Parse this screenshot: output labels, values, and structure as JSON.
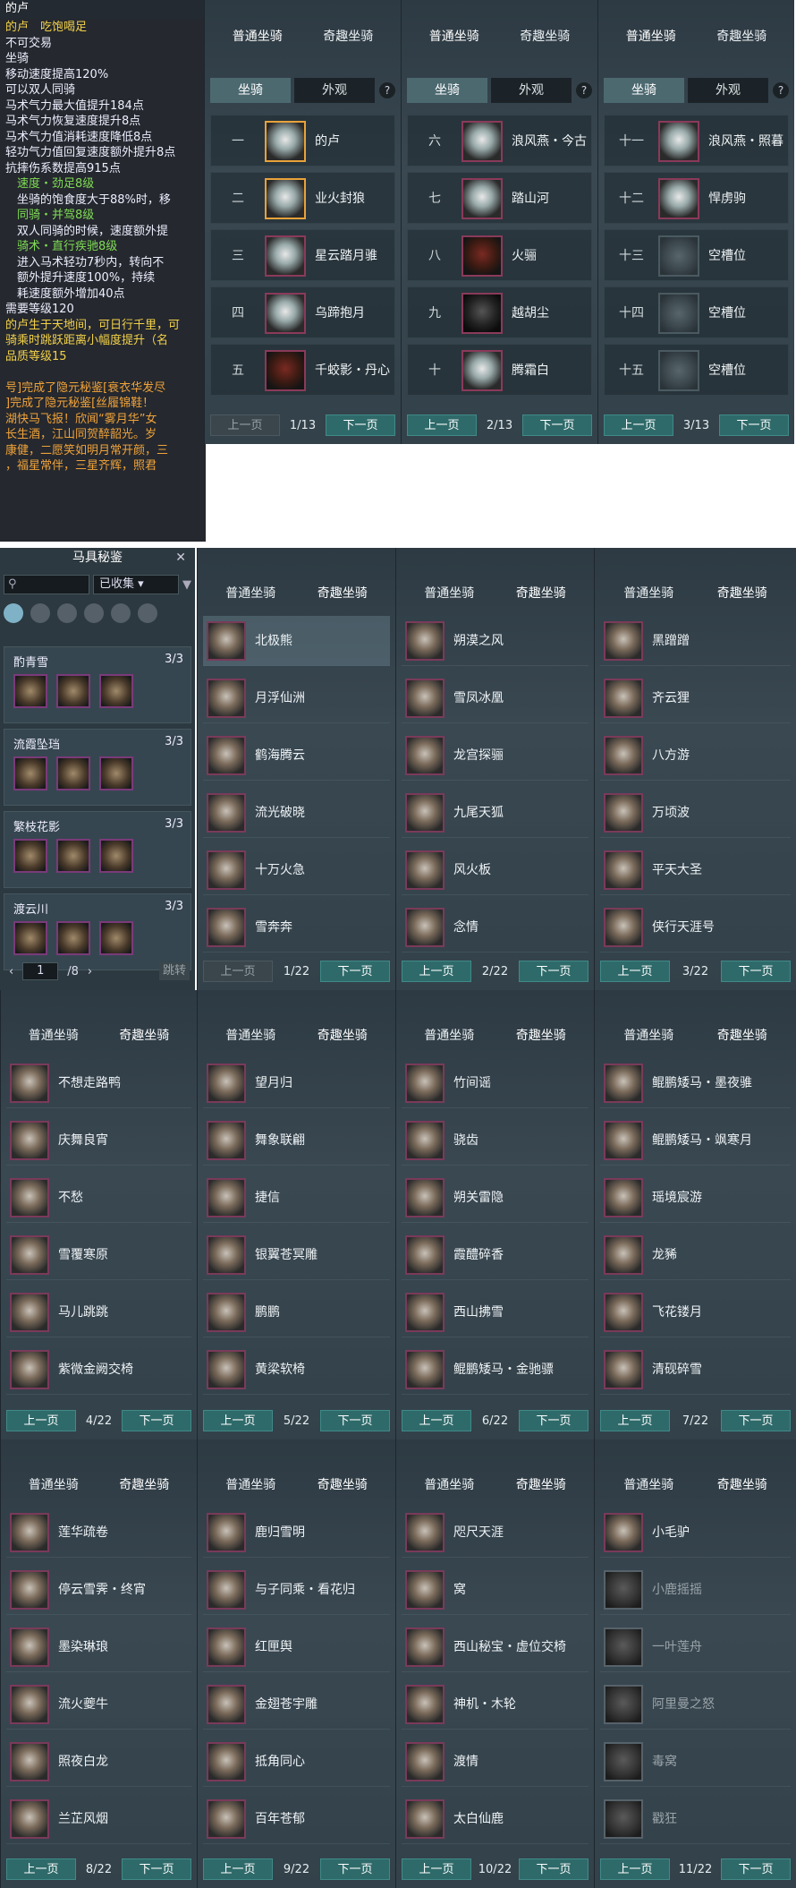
{
  "tooltip": {
    "title": "的卢",
    "lines": [
      {
        "t": "的卢　吃饱喝足",
        "c": "c-y"
      },
      {
        "t": "不可交易",
        "c": "c-w"
      },
      {
        "t": "坐骑",
        "c": "c-w"
      },
      {
        "t": "移动速度提高120%",
        "c": "c-w"
      },
      {
        "t": "可以双人同骑",
        "c": "c-w"
      },
      {
        "t": "马术气力最大值提升184点",
        "c": "c-w"
      },
      {
        "t": "马术气力恢复速度提升8点",
        "c": "c-w"
      },
      {
        "t": "马术气力值消耗速度降低8点",
        "c": "c-w"
      },
      {
        "t": "轻功气力值回复速度额外提升8点",
        "c": "c-w"
      },
      {
        "t": "抗摔伤系数提高915点",
        "c": "c-w"
      },
      {
        "t": "　速度・劲足8级",
        "c": "c-g"
      },
      {
        "t": "　坐骑的饱食度大于88%时，移",
        "c": "c-w"
      },
      {
        "t": "　同骑・并驾8级",
        "c": "c-g"
      },
      {
        "t": "　双人同骑的时候，速度额外提",
        "c": "c-w"
      },
      {
        "t": "　骑术・直行疾驰8级",
        "c": "c-g"
      },
      {
        "t": "　进入马术轻功7秒内，转向不",
        "c": "c-w"
      },
      {
        "t": "　额外提升速度100%，持续",
        "c": "c-w"
      },
      {
        "t": "　耗速度额外增加40点",
        "c": "c-w"
      },
      {
        "t": "需要等级120",
        "c": "c-w"
      },
      {
        "t": "的卢生于天地间，可日行千里，可",
        "c": "c-y"
      },
      {
        "t": "骑乘时跳跃距离小幅度提升（名",
        "c": "c-y"
      },
      {
        "t": "品质等级15",
        "c": "c-y"
      },
      {
        "t": "",
        "c": "c-w"
      },
      {
        "t": "号]完成了隐元秘鉴[衰衣华发尽",
        "c": "c-o"
      },
      {
        "t": "]完成了隐元秘鉴[丝履锦鞋！",
        "c": "c-o"
      },
      {
        "t": "湖快马飞报！欣闻“雾月华”女",
        "c": "c-o"
      },
      {
        "t": "长生酒，江山同贺醉韶光。岁",
        "c": "c-o"
      },
      {
        "t": "康健，二愿笑如明月常开颜，三",
        "c": "c-o"
      },
      {
        "t": "，福星常伴，三星齐辉，照君",
        "c": "c-o"
      }
    ]
  },
  "tabs": {
    "normal": "普通坐骑",
    "fun": "奇趣坐骑",
    "mount": "坐骑",
    "look": "外观",
    "help": "?"
  },
  "pager": {
    "prev": "上一页",
    "next": "下一页"
  },
  "mount_panels": [
    {
      "page": "1/13",
      "slots": [
        {
          "n": "一",
          "name": "的卢",
          "k": "sel"
        },
        {
          "n": "二",
          "name": "业火封狼",
          "k": "sel"
        },
        {
          "n": "三",
          "name": "星云踏月骓",
          "k": ""
        },
        {
          "n": "四",
          "name": "乌蹄抱月",
          "k": ""
        },
        {
          "n": "五",
          "name": "千蛟影・丹心",
          "k": "dark"
        }
      ]
    },
    {
      "page": "2/13",
      "slots": [
        {
          "n": "六",
          "name": "浪风燕・今古",
          "k": ""
        },
        {
          "n": "七",
          "name": "踏山河",
          "k": ""
        },
        {
          "n": "八",
          "name": "火骊",
          "k": "dark"
        },
        {
          "n": "九",
          "name": "越胡尘",
          "k": "black"
        },
        {
          "n": "十",
          "name": "腾霜白",
          "k": ""
        }
      ]
    },
    {
      "page": "3/13",
      "slots": [
        {
          "n": "十一",
          "name": "浪风燕・照暮",
          "k": ""
        },
        {
          "n": "十二",
          "name": "悍虏驹",
          "k": ""
        },
        {
          "n": "十三",
          "name": "空槽位",
          "k": "empty"
        },
        {
          "n": "十四",
          "name": "空槽位",
          "k": "empty"
        },
        {
          "n": "十五",
          "name": "空槽位",
          "k": "empty"
        }
      ]
    }
  ],
  "collection": {
    "title": "马具秘鉴",
    "close": "✕",
    "filter": "已收集 ▾",
    "search_icon": "⚲",
    "groups": [
      {
        "name": "酌青雪",
        "count": "3/3"
      },
      {
        "name": "流霞坠珰",
        "count": "3/3"
      },
      {
        "name": "繁枝花影",
        "count": "3/3"
      },
      {
        "name": "渡云川",
        "count": "3/3"
      }
    ],
    "page": "1",
    "total": "/8",
    "jump": "跳转"
  },
  "fun_panels": [
    {
      "page": "1/22",
      "items": [
        "北极熊",
        "月浮仙洲",
        "鹤海腾云",
        "流光破晓",
        "十万火急",
        "雪奔奔"
      ]
    },
    {
      "page": "2/22",
      "items": [
        "朔漠之风",
        "雪凤冰凰",
        "龙宫探骊",
        "九尾天狐",
        "风火板",
        "念情"
      ]
    },
    {
      "page": "3/22",
      "items": [
        "黑蹭蹭",
        "齐云狸",
        "八方游",
        "万顷波",
        "平天大圣",
        "侠行天涯号"
      ]
    },
    {
      "page": "4/22",
      "items": [
        "不想走路鸭",
        "庆舞良宵",
        "不愁",
        "雪覆寒原",
        "马儿跳跳",
        "紫微金阙交椅"
      ]
    },
    {
      "page": "5/22",
      "items": [
        "望月归",
        "舞象联翩",
        "捷信",
        "银翼苍冥雕",
        "鹏鹏",
        "黄梁软椅"
      ]
    },
    {
      "page": "6/22",
      "items": [
        "竹间谣",
        "骁齿",
        "朔关雷隐",
        "霞醴碎香",
        "西山拂雪",
        "鲲鹏矮马・金驰骠"
      ]
    },
    {
      "page": "7/22",
      "items": [
        "鲲鹏矮马・墨夜骓",
        "鲲鹏矮马・飒寒月",
        "瑶境宸游",
        "龙豨",
        "飞花镂月",
        "清砚碎雪"
      ]
    },
    {
      "page": "8/22",
      "items": [
        "莲华疏卷",
        "停云雪霁・终宵",
        "墨染琳琅",
        "流火夔牛",
        "照夜白龙",
        "兰芷风烟"
      ]
    },
    {
      "page": "9/22",
      "items": [
        "鹿归雪明",
        "与子同乘・看花归",
        "红匣舆",
        "金翅苍宇雕",
        "抵角同心",
        "百年苍郁"
      ]
    },
    {
      "page": "10/22",
      "items": [
        "咫尺天涯",
        "窝",
        "西山秘宝・虚位交椅",
        "神机・木轮",
        "渡情",
        "太白仙鹿"
      ]
    },
    {
      "page": "11/22",
      "items": [
        "小毛驴",
        "小鹿摇摇",
        "一叶莲舟",
        "阿里曼之怒",
        "毒窝",
        "戳狂"
      ]
    }
  ]
}
